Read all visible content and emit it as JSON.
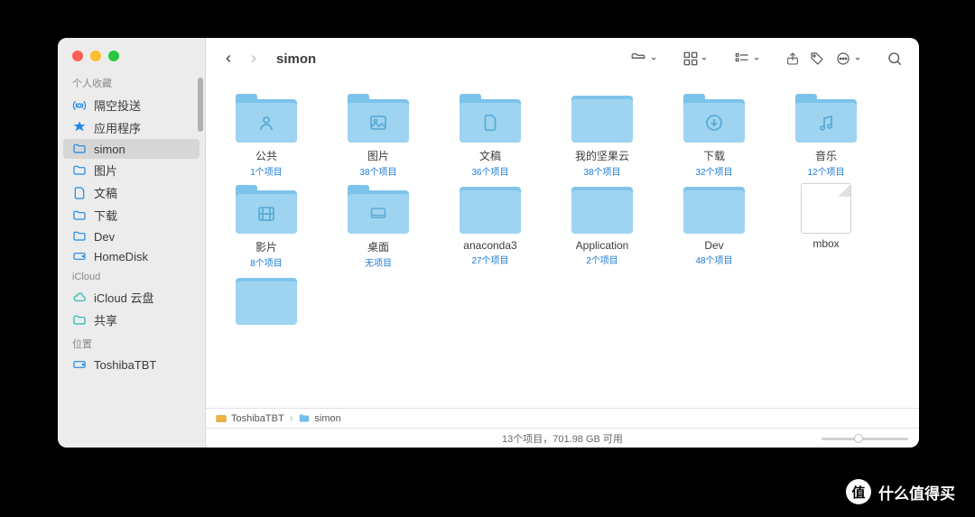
{
  "window": {
    "title": "simon"
  },
  "sidebar": {
    "sections": [
      {
        "title": "个人收藏",
        "items": [
          {
            "icon": "airdrop",
            "label": "隔空投送"
          },
          {
            "icon": "apps",
            "label": "应用程序"
          },
          {
            "icon": "folder",
            "label": "simon",
            "selected": true
          },
          {
            "icon": "folder",
            "label": "图片"
          },
          {
            "icon": "doc",
            "label": "文稿"
          },
          {
            "icon": "folder",
            "label": "下载"
          },
          {
            "icon": "folder",
            "label": "Dev"
          },
          {
            "icon": "disk",
            "label": "HomeDisk"
          }
        ]
      },
      {
        "title": "iCloud",
        "items": [
          {
            "icon": "icloud",
            "label": "iCloud 云盘"
          },
          {
            "icon": "shared",
            "label": "共享"
          }
        ]
      },
      {
        "title": "位置",
        "items": [
          {
            "icon": "disk",
            "label": "ToshibaTBT"
          }
        ]
      }
    ]
  },
  "items": [
    {
      "name": "公共",
      "meta": "1个项目",
      "glyph": "person"
    },
    {
      "name": "图片",
      "meta": "38个项目",
      "glyph": "image"
    },
    {
      "name": "文稿",
      "meta": "36个项目",
      "glyph": "doc"
    },
    {
      "name": "我的坚果云",
      "meta": "38个项目",
      "glyph": "plain"
    },
    {
      "name": "下载",
      "meta": "32个项目",
      "glyph": "download"
    },
    {
      "name": "音乐",
      "meta": "12个项目",
      "glyph": "music"
    },
    {
      "name": "影片",
      "meta": "8个项目",
      "glyph": "movie"
    },
    {
      "name": "桌面",
      "meta": "无项目",
      "glyph": "desktop"
    },
    {
      "name": "anaconda3",
      "meta": "27个项目",
      "glyph": "plain"
    },
    {
      "name": "Application",
      "meta": "2个项目",
      "glyph": "plain"
    },
    {
      "name": "Dev",
      "meta": "48个项目",
      "glyph": "plain"
    },
    {
      "name": "mbox",
      "meta": "",
      "glyph": "file"
    },
    {
      "name": "",
      "meta": "",
      "glyph": "plain"
    }
  ],
  "pathbar": {
    "root": "ToshibaTBT",
    "leaf": "simon"
  },
  "status": "13个项目，701.98 GB 可用",
  "watermark": "什么值得买"
}
